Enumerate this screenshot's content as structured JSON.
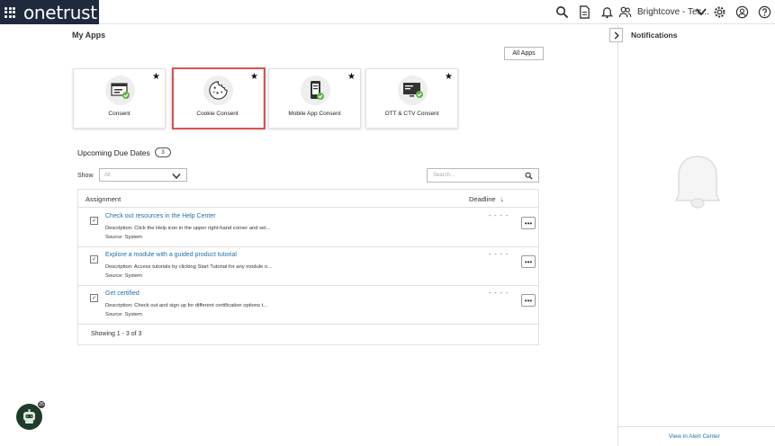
{
  "brand": {
    "name": "onetrust"
  },
  "header": {
    "org_name": "Brightcove - Tec...",
    "icons": [
      "search-icon",
      "document-icon",
      "bell-icon",
      "users-icon",
      "gear-icon",
      "user-circle-icon",
      "help-icon"
    ]
  },
  "my_apps": {
    "title": "My Apps",
    "all_apps_label": "All Apps",
    "apps": [
      {
        "label": "Consent",
        "icon": "consent-app-icon"
      },
      {
        "label": "Cookie Consent",
        "icon": "cookie-icon"
      },
      {
        "label": "Mobile App Consent",
        "icon": "mobile-app-icon"
      },
      {
        "label": "OTT & CTV Consent",
        "icon": "tv-icon"
      }
    ]
  },
  "due_dates": {
    "title": "Upcoming Due Dates",
    "count": "3",
    "show_label": "Show",
    "show_value": "All",
    "search_placeholder": "Search...",
    "col_assignment": "Assignment",
    "col_deadline": "Deadline",
    "rows": [
      {
        "title": "Check out resources in the Help Center",
        "description": "Description: Click the Help icon in the upper right-hand corner and sel...",
        "source": "Source: System",
        "deadline": "- - - -"
      },
      {
        "title": "Explore a module with a guided product tutorial",
        "description": "Description: Access tutorials by clicking Start Tutorial for any module o...",
        "source": "Source: System",
        "deadline": "- - - -"
      },
      {
        "title": "Get certified",
        "description": "Description: Check out and sign up for different certification options t...",
        "source": "Source: System",
        "deadline": "- - - -"
      }
    ],
    "showing": "Showing 1 - 3 of 3"
  },
  "notifications": {
    "title": "Notifications",
    "footer_link": "View in Alert Center"
  },
  "assistant": {
    "badge": "26"
  },
  "colors": {
    "topbar_logo_bg": "#1f2a3c",
    "link": "#1f6fae",
    "highlight": "#d9534f"
  }
}
